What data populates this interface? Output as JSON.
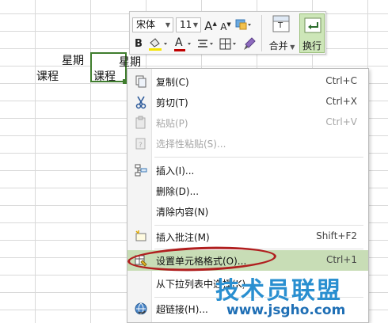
{
  "spreadsheet": {
    "cell_a_week": "星期",
    "cell_a_course": "课程",
    "cell_b_week": "星期",
    "cell_b_course": "课程"
  },
  "mini_toolbar": {
    "font_name": "宋体",
    "font_size": "11",
    "grow_font": "A",
    "shrink_font": "A",
    "bold": "B",
    "font_color_letter": "A",
    "merge_label": "合并",
    "wrap_label": "换行",
    "accent_color": "#c00000",
    "wrap_highlight": "#cde6b8"
  },
  "context_menu": {
    "items": [
      {
        "label": "复制(C)",
        "shortcut": "Ctrl+C",
        "icon": "copy-icon"
      },
      {
        "label": "剪切(T)",
        "shortcut": "Ctrl+X",
        "icon": "scissors-icon"
      },
      {
        "label": "粘贴(P)",
        "shortcut": "Ctrl+V",
        "icon": "paste-icon"
      },
      {
        "label": "选择性粘贴(S)...",
        "shortcut": "",
        "icon": "paste-special-icon"
      },
      {
        "label": "插入(I)...",
        "shortcut": "",
        "icon": "insert-icon"
      },
      {
        "label": "删除(D)...",
        "shortcut": ""
      },
      {
        "label": "清除内容(N)",
        "shortcut": ""
      },
      {
        "label": "插入批注(M)",
        "shortcut": "Shift+F2",
        "icon": "comment-icon"
      },
      {
        "label": "设置单元格格式(O)...",
        "shortcut": "Ctrl+1",
        "icon": "format-cells-icon"
      },
      {
        "label": "从下拉列表中选择(K)...",
        "shortcut": ""
      },
      {
        "label": "超链接(H)...",
        "shortcut": "",
        "icon": "hyperlink-icon"
      }
    ],
    "highlight_color": "#c8ddb6",
    "ring_color": "#b01f1f"
  },
  "watermark": {
    "title": "技术员联盟",
    "url": "www.jsgho.com",
    "com_suffix": ".com"
  }
}
